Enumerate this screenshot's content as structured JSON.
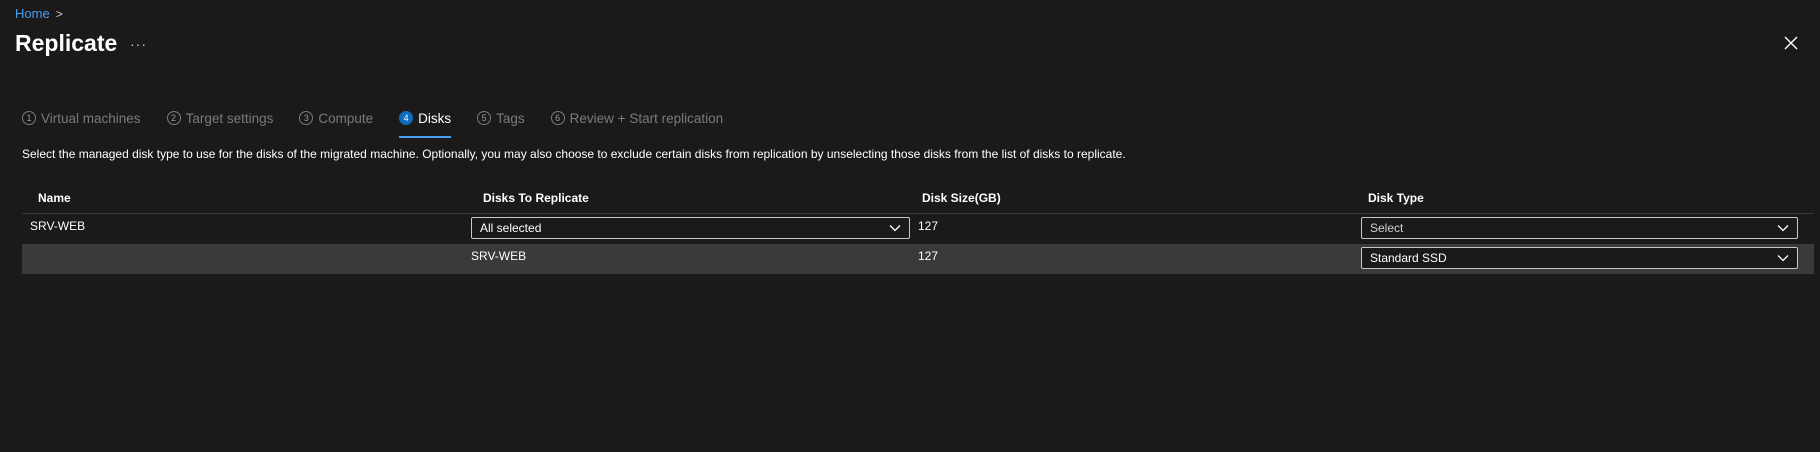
{
  "breadcrumb": {
    "home": "Home",
    "separator": ">"
  },
  "page": {
    "title": "Replicate",
    "more": "···"
  },
  "tabs": [
    {
      "num": "1",
      "label": "Virtual machines",
      "active": false
    },
    {
      "num": "2",
      "label": "Target settings",
      "active": false
    },
    {
      "num": "3",
      "label": "Compute",
      "active": false
    },
    {
      "num": "4",
      "label": "Disks",
      "active": true
    },
    {
      "num": "5",
      "label": "Tags",
      "active": false
    },
    {
      "num": "6",
      "label": "Review + Start replication",
      "active": false
    }
  ],
  "description": "Select the managed disk type to use for the disks of the migrated machine. Optionally, you may also choose to exclude certain disks from replication by unselecting those disks from the list of disks to replicate.",
  "table": {
    "columns": [
      "Name",
      "Disks To Replicate",
      "Disk Size(GB)",
      "Disk Type"
    ],
    "rows": [
      {
        "name": "SRV-WEB",
        "disks": "All selected",
        "size": "127",
        "type": "Select"
      },
      {
        "name": "",
        "disks": "SRV-WEB",
        "size": "127",
        "type": "Standard SSD"
      }
    ]
  },
  "colors": {
    "accent": "#0f6cbd",
    "link": "#479ef5",
    "background": "#1b1a19",
    "selected_row": "#3b3a39"
  },
  "icons": {
    "close": "close-icon",
    "chevron": "chevron-down-icon",
    "more": "more-icon"
  }
}
